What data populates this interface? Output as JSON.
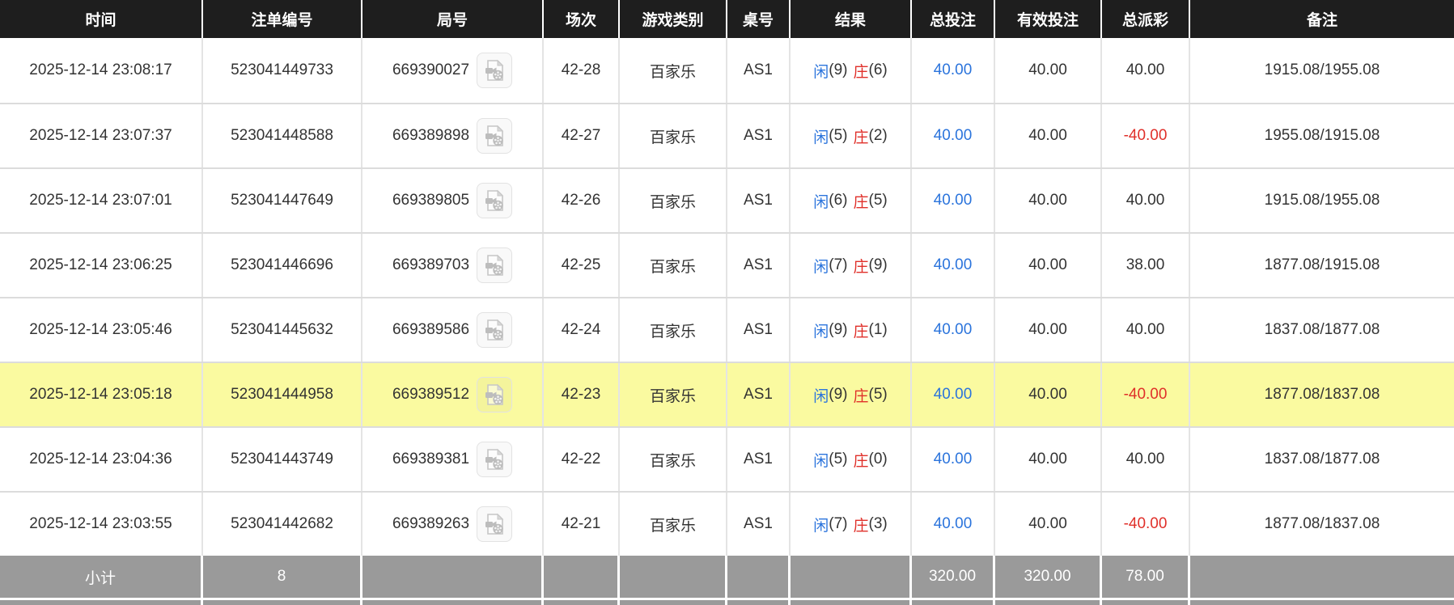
{
  "colors": {
    "header_bg": "#1e1e1e",
    "highlight_yellow": "#fafaa0",
    "subtotal_bg": "#9a9a9a",
    "accent_blue": "#2b74dc",
    "accent_red": "#e0302a"
  },
  "table": {
    "headers": [
      "时间",
      "注单编号",
      "局号",
      "场次",
      "游戏类别",
      "桌号",
      "结果",
      "总投注",
      "有效投注",
      "总派彩",
      "备注"
    ],
    "video_icon": "video-replay-file-icon",
    "rows": [
      {
        "time": "2025-12-14 23:08:17",
        "bet_id": "523041449733",
        "round_id": "669390027",
        "session": "42-28",
        "game_type": "百家乐",
        "table_no": "AS1",
        "result": {
          "player_label": "闲",
          "player_score": "(9)",
          "banker_label": "庄",
          "banker_score": "(6)"
        },
        "total_bet": "40.00",
        "valid_bet": "40.00",
        "payout": "40.00",
        "note": "1915.08/1955.08",
        "highlighted": false
      },
      {
        "time": "2025-12-14 23:07:37",
        "bet_id": "523041448588",
        "round_id": "669389898",
        "session": "42-27",
        "game_type": "百家乐",
        "table_no": "AS1",
        "result": {
          "player_label": "闲",
          "player_score": "(5)",
          "banker_label": "庄",
          "banker_score": "(2)"
        },
        "total_bet": "40.00",
        "valid_bet": "40.00",
        "payout": "-40.00",
        "note": "1955.08/1915.08",
        "highlighted": false
      },
      {
        "time": "2025-12-14 23:07:01",
        "bet_id": "523041447649",
        "round_id": "669389805",
        "session": "42-26",
        "game_type": "百家乐",
        "table_no": "AS1",
        "result": {
          "player_label": "闲",
          "player_score": "(6)",
          "banker_label": "庄",
          "banker_score": "(5)"
        },
        "total_bet": "40.00",
        "valid_bet": "40.00",
        "payout": "40.00",
        "note": "1915.08/1955.08",
        "highlighted": false
      },
      {
        "time": "2025-12-14 23:06:25",
        "bet_id": "523041446696",
        "round_id": "669389703",
        "session": "42-25",
        "game_type": "百家乐",
        "table_no": "AS1",
        "result": {
          "player_label": "闲",
          "player_score": "(7)",
          "banker_label": "庄",
          "banker_score": "(9)"
        },
        "total_bet": "40.00",
        "valid_bet": "40.00",
        "payout": "38.00",
        "note": "1877.08/1915.08",
        "highlighted": false
      },
      {
        "time": "2025-12-14 23:05:46",
        "bet_id": "523041445632",
        "round_id": "669389586",
        "session": "42-24",
        "game_type": "百家乐",
        "table_no": "AS1",
        "result": {
          "player_label": "闲",
          "player_score": "(9)",
          "banker_label": "庄",
          "banker_score": "(1)"
        },
        "total_bet": "40.00",
        "valid_bet": "40.00",
        "payout": "40.00",
        "note": "1837.08/1877.08",
        "highlighted": false
      },
      {
        "time": "2025-12-14 23:05:18",
        "bet_id": "523041444958",
        "round_id": "669389512",
        "session": "42-23",
        "game_type": "百家乐",
        "table_no": "AS1",
        "result": {
          "player_label": "闲",
          "player_score": "(9)",
          "banker_label": "庄",
          "banker_score": "(5)"
        },
        "total_bet": "40.00",
        "valid_bet": "40.00",
        "payout": "-40.00",
        "note": "1877.08/1837.08",
        "highlighted": true
      },
      {
        "time": "2025-12-14 23:04:36",
        "bet_id": "523041443749",
        "round_id": "669389381",
        "session": "42-22",
        "game_type": "百家乐",
        "table_no": "AS1",
        "result": {
          "player_label": "闲",
          "player_score": "(5)",
          "banker_label": "庄",
          "banker_score": "(0)"
        },
        "total_bet": "40.00",
        "valid_bet": "40.00",
        "payout": "40.00",
        "note": "1837.08/1877.08",
        "highlighted": false
      },
      {
        "time": "2025-12-14 23:03:55",
        "bet_id": "523041442682",
        "round_id": "669389263",
        "session": "42-21",
        "game_type": "百家乐",
        "table_no": "AS1",
        "result": {
          "player_label": "闲",
          "player_score": "(7)",
          "banker_label": "庄",
          "banker_score": "(3)"
        },
        "total_bet": "40.00",
        "valid_bet": "40.00",
        "payout": "-40.00",
        "note": "1877.08/1837.08",
        "highlighted": false
      }
    ],
    "subtotal": {
      "label": "小计",
      "count": "8",
      "total_bet": "320.00",
      "valid_bet": "320.00",
      "payout": "78.00"
    }
  }
}
